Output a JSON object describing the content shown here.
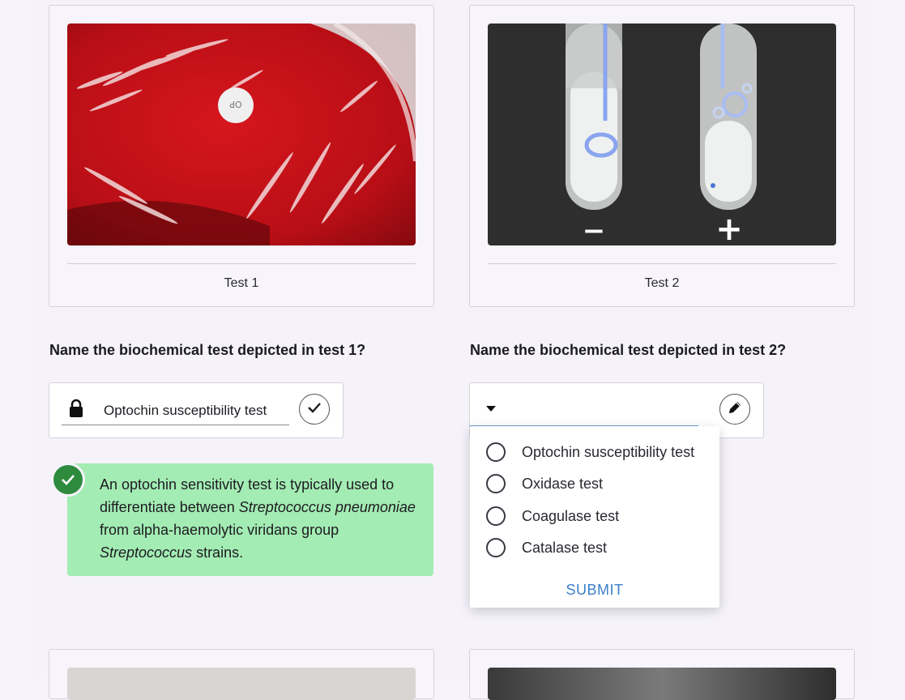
{
  "cards": [
    {
      "caption": "Test 1"
    },
    {
      "caption": "Test 2"
    }
  ],
  "questions": {
    "q1": "Name the biochemical test depicted in test 1?",
    "q2": "Name the biochemical test depicted in test 2?"
  },
  "answer1": {
    "value": "Optochin susceptibility test",
    "status": "correct"
  },
  "feedback": {
    "part1": "An optochin sensitivity test is typically used to differentiate between ",
    "italic1": "Streptococcus pneumoniae",
    "part2": " from alpha-haemolytic viridans group ",
    "italic2": "Streptococcus",
    "part3": " strains."
  },
  "answer2": {
    "value": "",
    "options": [
      "Optochin susceptibility test",
      "Oxidase test",
      "Coagulase test",
      "Catalase test"
    ],
    "submit_label": "SUBMIT"
  },
  "test2_image_labels": {
    "left": "−",
    "right": "+"
  },
  "disc_label": "OP",
  "colors": {
    "accent": "#3b7fc9",
    "success": "#2e8b3e",
    "feedback_bg": "#a3ecb3",
    "agar_red": "#c4141b"
  }
}
